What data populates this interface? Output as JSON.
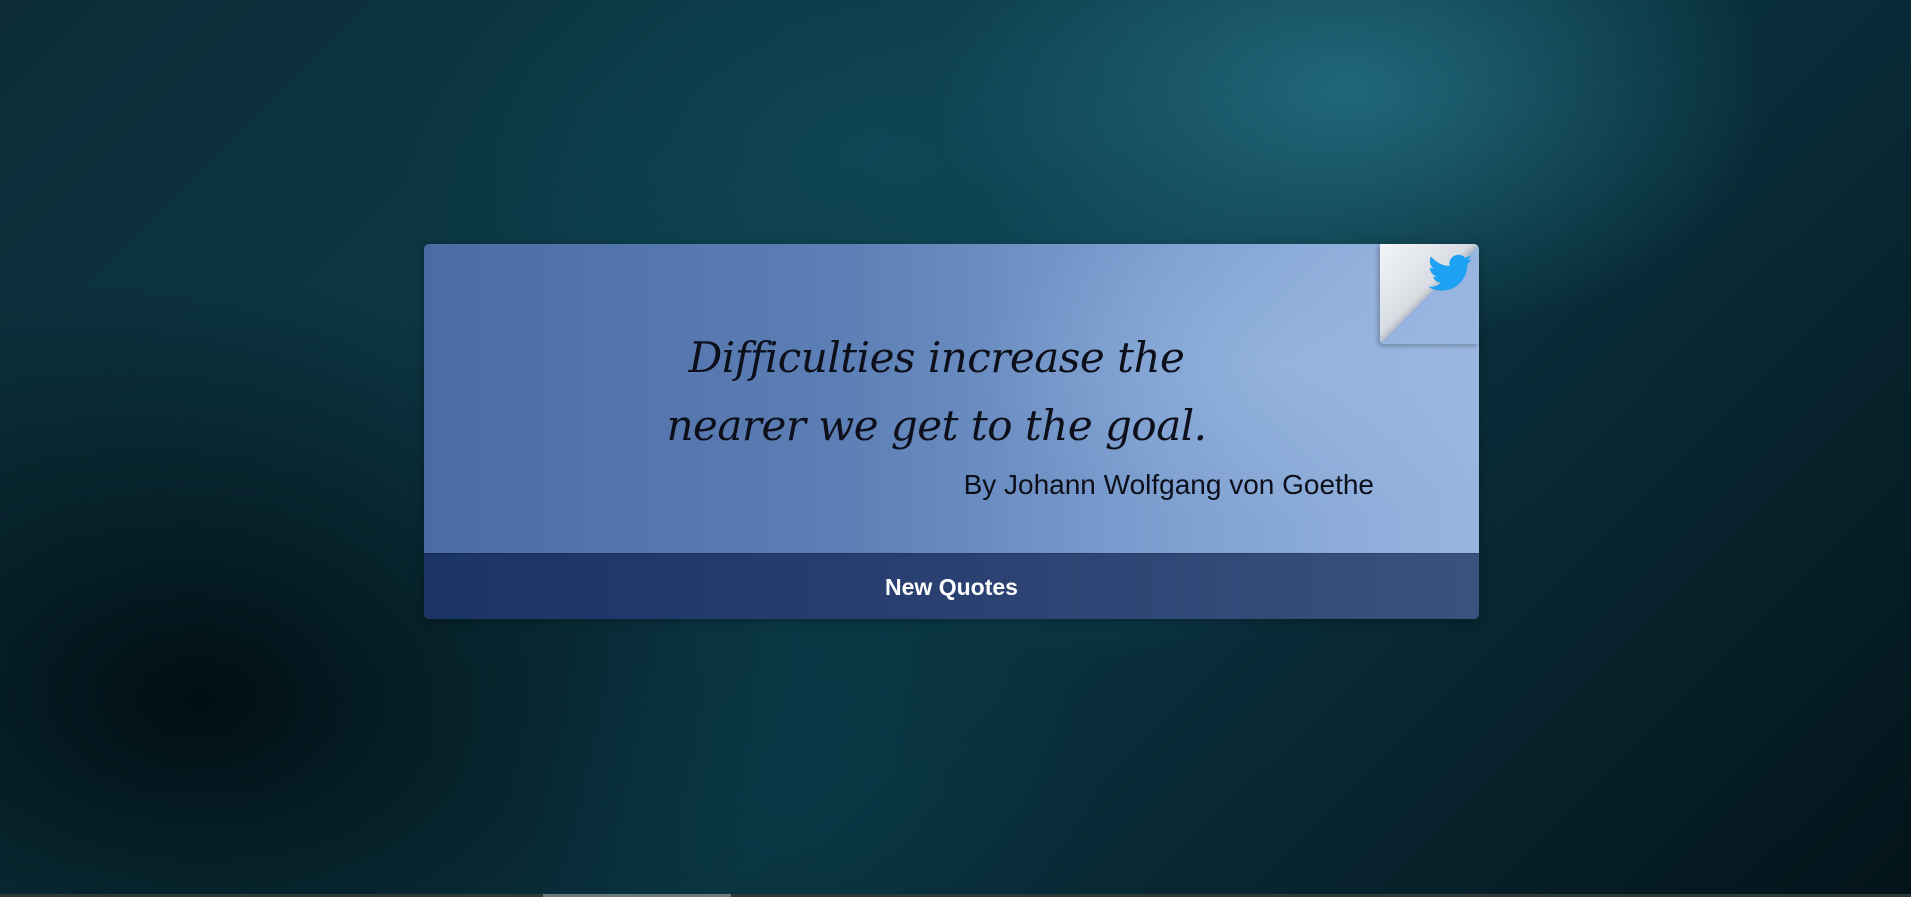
{
  "quote": {
    "lines": [
      "Difficulties increase the",
      "nearer we get to the goal."
    ],
    "author": "By Johann Wolfgang von Goethe"
  },
  "actions": {
    "new_quote_label": "New Quotes",
    "tweet_icon": "twitter-bird-icon"
  },
  "colors": {
    "twitter_blue": "#1da1f2",
    "button_bg": "#2a4170",
    "card_bg": "#6f8fc4"
  }
}
